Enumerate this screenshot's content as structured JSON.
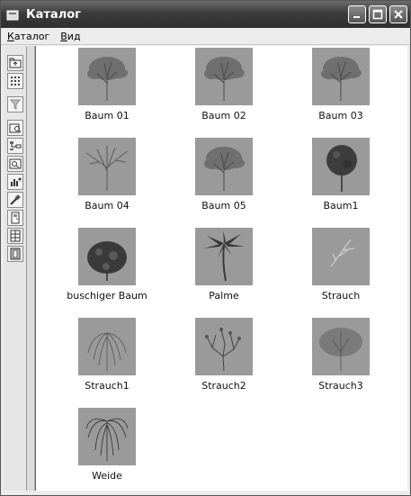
{
  "window": {
    "title": "Каталог"
  },
  "menu": [
    {
      "label": "Каталог",
      "accel": "К",
      "rest": "аталог"
    },
    {
      "label": "Вид",
      "accel": "В",
      "rest": "ид"
    }
  ],
  "toolbar": {
    "tools": [
      "folder-up-icon",
      "list-view-icon",
      "filter-icon",
      "folder-search-icon",
      "tree-view-icon",
      "image-search-icon",
      "chart-icon",
      "eyedropper-icon",
      "door-icon",
      "window-icon",
      "frame-icon"
    ]
  },
  "catalog": {
    "items": [
      {
        "label": "Baum 01",
        "icon": "tree"
      },
      {
        "label": "Baum 02",
        "icon": "tree"
      },
      {
        "label": "Baum 03",
        "icon": "tree"
      },
      {
        "label": "Baum 04",
        "icon": "tree-bare"
      },
      {
        "label": "Baum 05",
        "icon": "tree"
      },
      {
        "label": "Baum1",
        "icon": "tree-round"
      },
      {
        "label": "buschiger Baum",
        "icon": "bush"
      },
      {
        "label": "Palme",
        "icon": "palm"
      },
      {
        "label": "Strauch",
        "icon": "shrub-light"
      },
      {
        "label": "Strauch1",
        "icon": "shrub-willow"
      },
      {
        "label": "Strauch2",
        "icon": "shrub-branchy"
      },
      {
        "label": "Strauch3",
        "icon": "shrub-dense"
      },
      {
        "label": "Weide",
        "icon": "willow"
      }
    ]
  },
  "colors": {
    "thumb_bg": "#9a9a9a",
    "titlebar": "#3c3c3c"
  }
}
